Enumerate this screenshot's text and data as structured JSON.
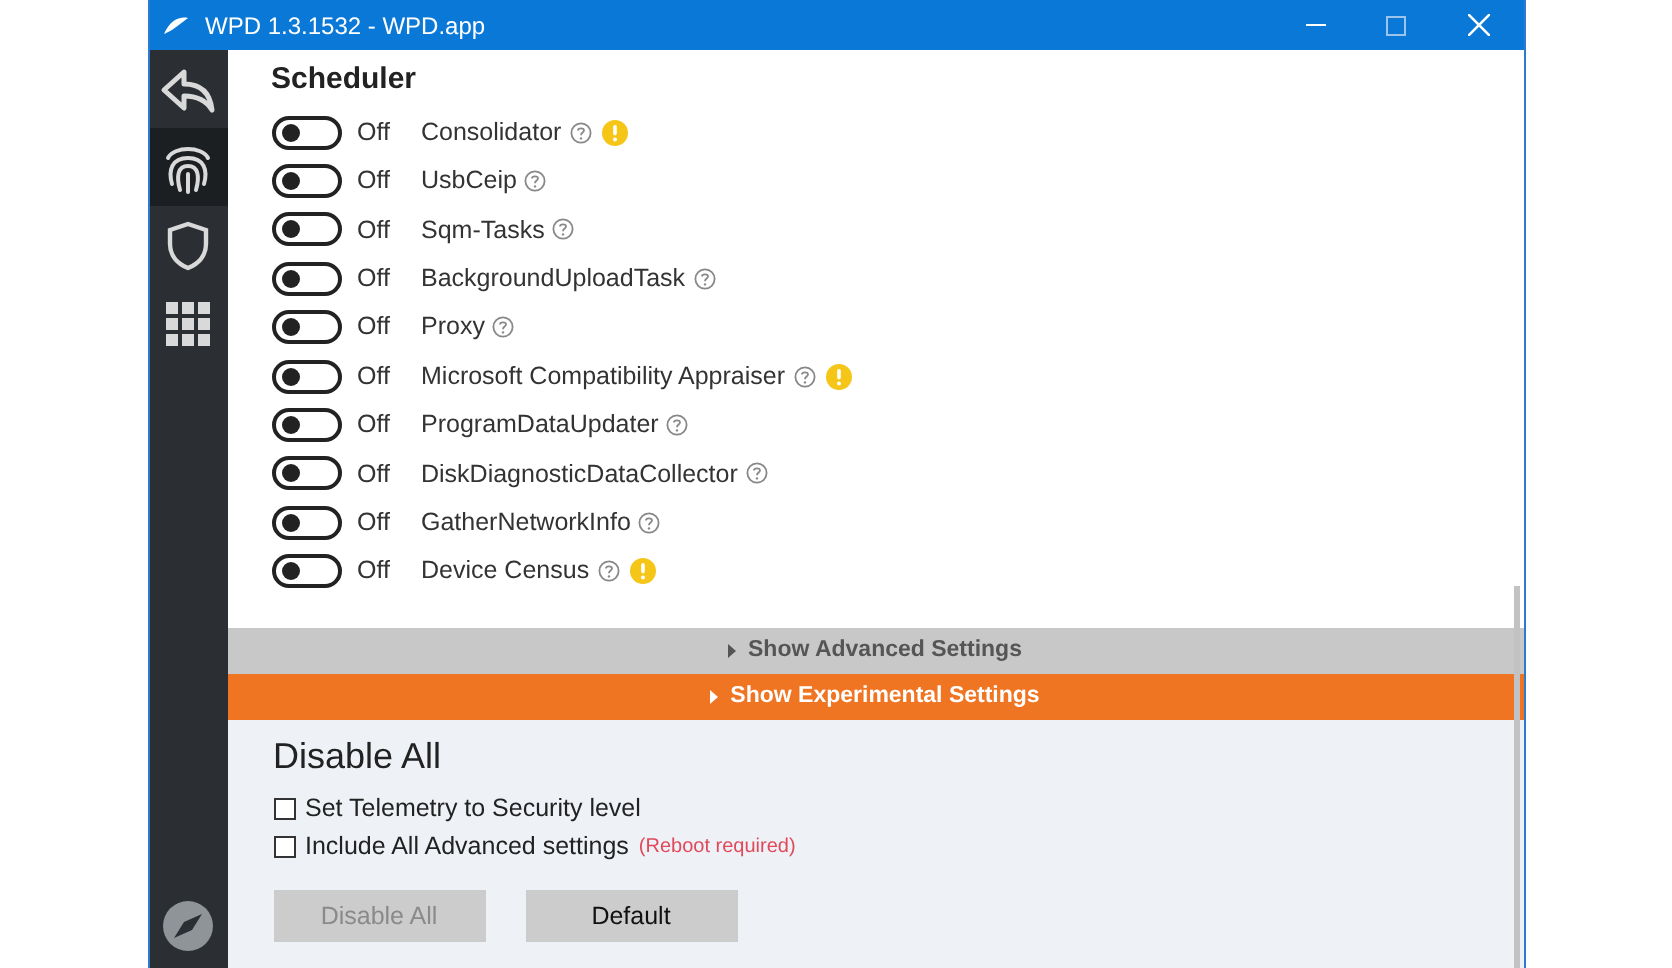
{
  "window": {
    "title": "WPD 1.3.1532 - WPD.app"
  },
  "sidebar": {
    "items": [
      {
        "kind": "back",
        "selected": false
      },
      {
        "kind": "fingerprint",
        "selected": true
      },
      {
        "kind": "shield",
        "selected": false
      },
      {
        "kind": "grid",
        "selected": false
      }
    ]
  },
  "section": {
    "title": "Scheduler",
    "rows": [
      {
        "state": "Off",
        "on": false,
        "label": "Consolidator",
        "warning": true
      },
      {
        "state": "Off",
        "on": false,
        "label": "UsbCeip",
        "warning": false
      },
      {
        "state": "Off",
        "on": false,
        "label": "Sqm-Tasks",
        "warning": false
      },
      {
        "state": "Off",
        "on": false,
        "label": "BackgroundUploadTask",
        "warning": false
      },
      {
        "state": "Off",
        "on": false,
        "label": "Proxy",
        "warning": false
      },
      {
        "state": "Off",
        "on": false,
        "label": "Microsoft Compatibility Appraiser",
        "warning": true
      },
      {
        "state": "Off",
        "on": false,
        "label": "ProgramDataUpdater",
        "warning": false
      },
      {
        "state": "Off",
        "on": false,
        "label": "DiskDiagnosticDataCollector",
        "warning": false
      },
      {
        "state": "Off",
        "on": false,
        "label": "GatherNetworkInfo",
        "warning": false
      },
      {
        "state": "Off",
        "on": false,
        "label": "Device Census",
        "warning": true
      }
    ]
  },
  "expanders": [
    {
      "kind": "advanced",
      "label": "Show Advanced Settings"
    },
    {
      "kind": "experimental",
      "label": "Show Experimental Settings"
    }
  ],
  "disable_all": {
    "title": "Disable All",
    "options": [
      {
        "label": "Set Telemetry to Security level",
        "checked": false
      },
      {
        "label": "Include All Advanced settings",
        "checked": false,
        "note": "(Reboot required)"
      }
    ],
    "buttons": [
      {
        "label": "Disable All",
        "disabled": true
      },
      {
        "label": "Default",
        "disabled": false
      }
    ]
  }
}
